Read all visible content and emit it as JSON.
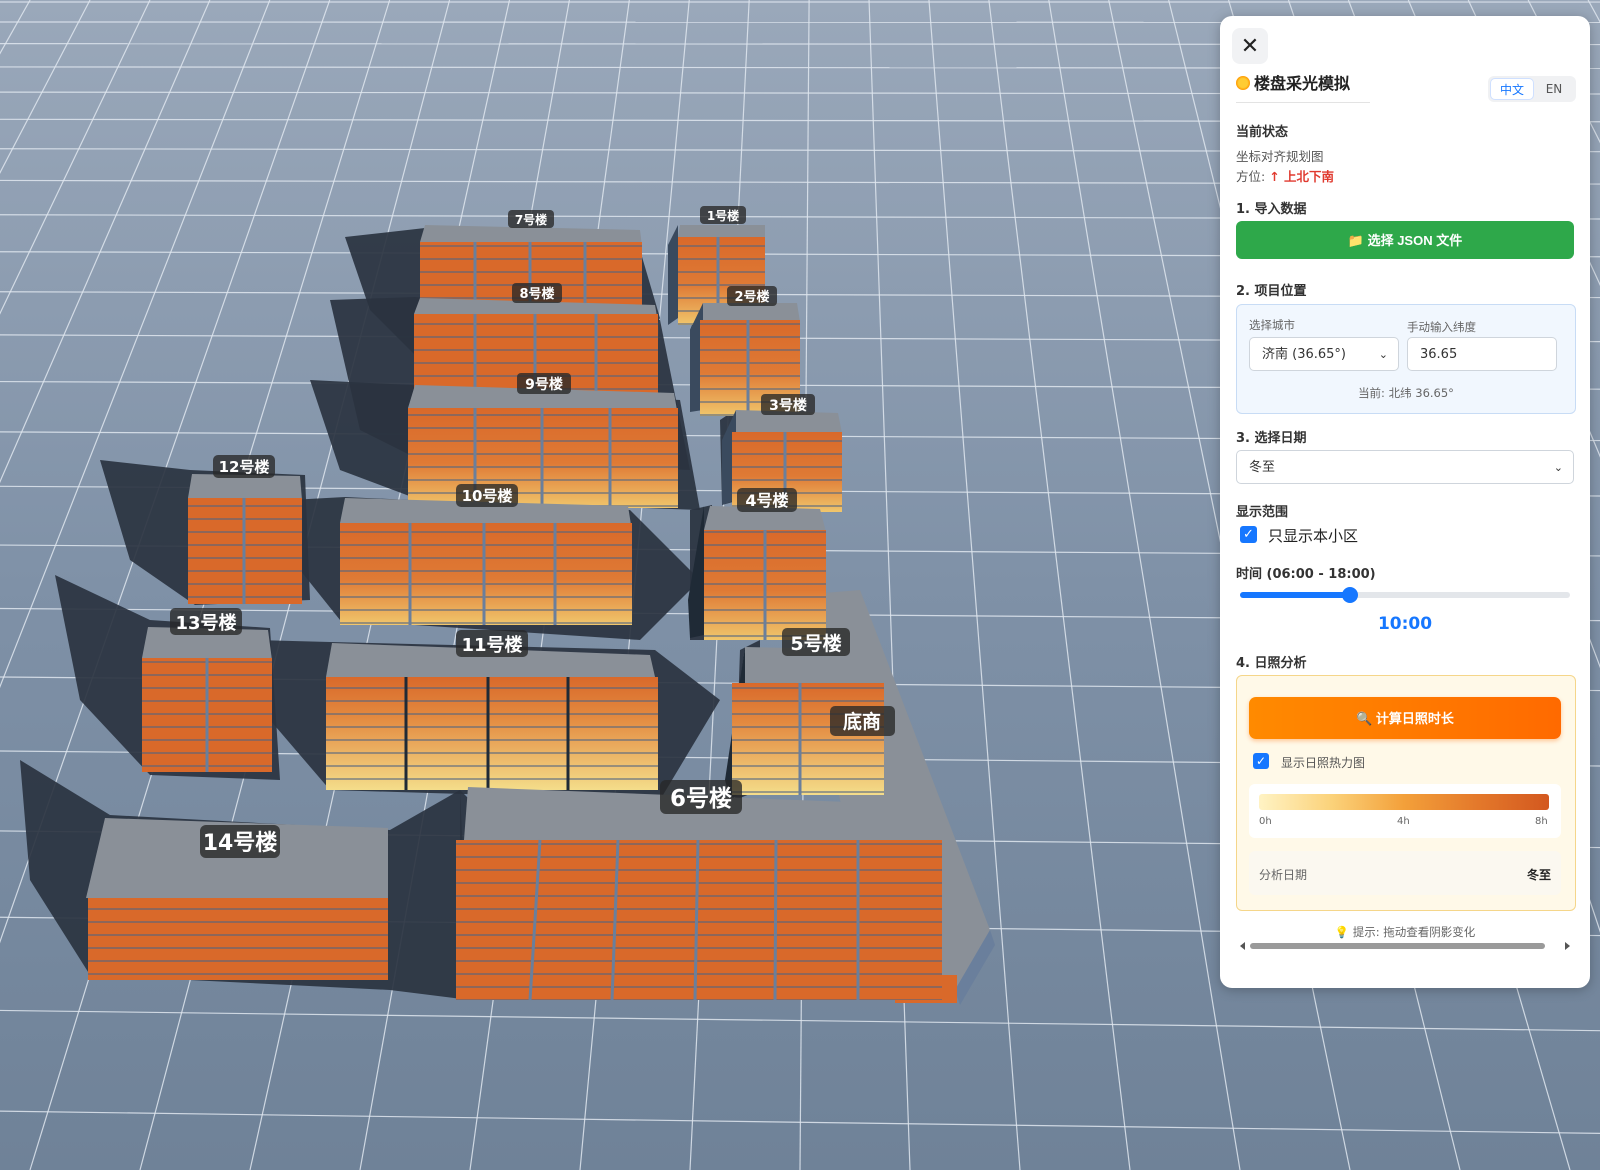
{
  "panel": {
    "close_label": "✕",
    "title": "楼盘采光模拟",
    "lang_zh": "中文",
    "lang_en": "EN",
    "status_heading": "当前状态",
    "status_line": "坐标对齐规划图",
    "direction_label": "方位:",
    "direction_value": "↑ 上北下南",
    "import_heading": "1. 导入数据",
    "import_button": "📁 选择 JSON 文件",
    "location_heading": "2. 项目位置",
    "city_label": "选择城市",
    "city_value": "济南 (36.65°)",
    "lat_label": "手动输入纬度",
    "lat_value": "36.65",
    "lat_current": "当前: 北纬 36.65°",
    "date_heading": "3. 选择日期",
    "date_value": "冬至",
    "range_heading": "显示范围",
    "only_community_label": "只显示本小区",
    "only_community_checked": true,
    "time_heading": "时间 (06:00 - 18:00)",
    "time_value": "10:00",
    "time_fraction": 0.333,
    "analysis_heading": "4. 日照分析",
    "calc_button": "🔍 计算日照时长",
    "heatmap_label": "显示日照热力图",
    "heatmap_checked": true,
    "legend_min": "0h",
    "legend_mid": "4h",
    "legend_max": "8h",
    "analysis_date_label": "分析日期",
    "analysis_date_value": "冬至",
    "hint": "💡 提示: 拖动查看阴影变化"
  },
  "buildings": {
    "b1": "1号楼",
    "b2": "2号楼",
    "b3": "3号楼",
    "b4": "4号楼",
    "b5": "5号楼",
    "b6": "6号楼",
    "b7": "7号楼",
    "b8": "8号楼",
    "b9": "9号楼",
    "b10": "10号楼",
    "b11": "11号楼",
    "b12": "12号楼",
    "b13": "13号楼",
    "b14": "14号楼",
    "shop": "底商"
  },
  "colors": {
    "background": "#8a9bb0",
    "grid_line": "#dfe6ee",
    "shadow": "#2a3340",
    "roof": "#8a9098",
    "facade": "#d9692a",
    "facade_lit": "#f0c66c",
    "accent": "#1677ff",
    "green": "#2ea84a",
    "orange": "#ff7a00"
  }
}
